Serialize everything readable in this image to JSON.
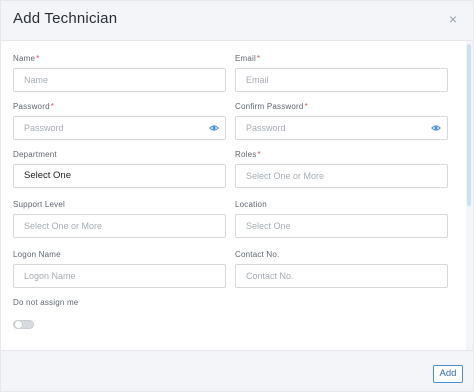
{
  "modal": {
    "title": "Add Technician",
    "close_symbol": "×",
    "close_icon": "close-icon"
  },
  "form": {
    "name": {
      "label": "Name",
      "required": "*",
      "placeholder": "Name"
    },
    "email": {
      "label": "Email",
      "required": "*",
      "placeholder": "Email"
    },
    "password": {
      "label": "Password",
      "required": "*",
      "placeholder": "Password",
      "icon": "eye-icon"
    },
    "confirm_password": {
      "label": "Confirm Password",
      "required": "*",
      "placeholder": "Password",
      "icon": "eye-icon"
    },
    "department": {
      "label": "Department",
      "value": "Select One"
    },
    "roles": {
      "label": "Roles",
      "required": "*",
      "placeholder": "Select One or More"
    },
    "support_level": {
      "label": "Support Level",
      "placeholder": "Select One or More"
    },
    "location": {
      "label": "Location",
      "placeholder": "Select One"
    },
    "logon_name": {
      "label": "Logon Name",
      "placeholder": "Logon Name"
    },
    "contact_no": {
      "label": "Contact No.",
      "placeholder": "Contact No."
    },
    "do_not_assign": {
      "label": "Do not assign me",
      "toggle_on": false
    }
  },
  "footer": {
    "add_label": "Add"
  },
  "colors": {
    "accent": "#2f6fb2",
    "required": "#e05252",
    "header_bg": "#f3f5f8"
  }
}
